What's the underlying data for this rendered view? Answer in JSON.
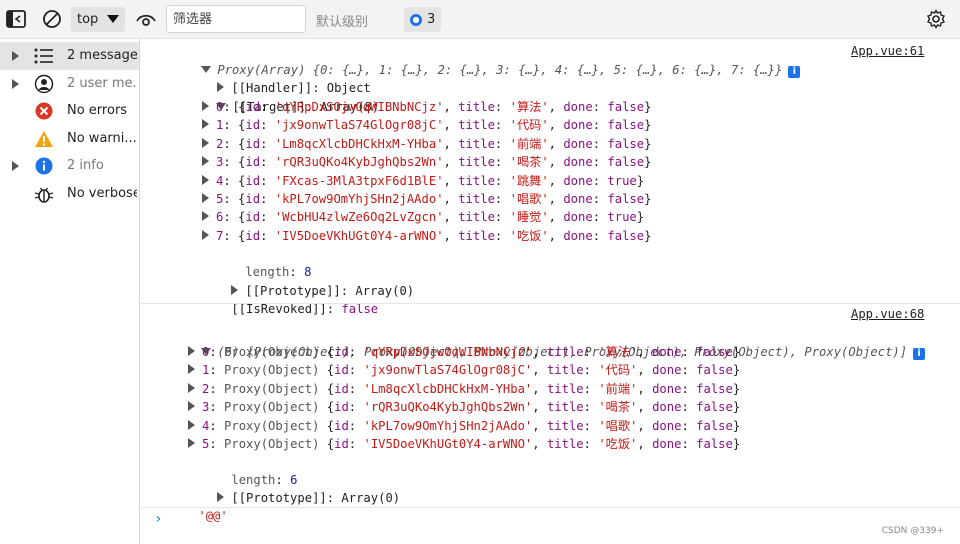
{
  "toolbar": {
    "context": "top",
    "filter_placeholder": "筛选器",
    "level": "默认级别",
    "issues_count": "3"
  },
  "sidebar": {
    "items": [
      {
        "label": "2 messages",
        "icon": "list-icon"
      },
      {
        "label": "2 user me...",
        "icon": "user-icon"
      },
      {
        "label": "No errors",
        "icon": "error-icon"
      },
      {
        "label": "No warni...",
        "icon": "warning-icon"
      },
      {
        "label": "2 info",
        "icon": "info-icon"
      },
      {
        "label": "No verbose",
        "icon": "bug-icon"
      }
    ]
  },
  "console": {
    "msg1": {
      "source": "App.vue:61",
      "summary": "Proxy(Array) {0: {…}, 1: {…}, 2: {…}, 3: {…}, 4: {…}, 5: {…}, 6: {…}, 7: {…}}",
      "handler": "[[Handler]]: Object",
      "target": "[[Target]]: Array(8)",
      "items": [
        {
          "idx": "0",
          "id": "qYRpDxSOjwOqWIBNbNCjz",
          "title": "算法",
          "done": "false"
        },
        {
          "idx": "1",
          "id": "jx9onwTlaS74GlOgr08jC",
          "title": "代码",
          "done": "false"
        },
        {
          "idx": "2",
          "id": "Lm8qcXlcbDHCkHxM-YHba",
          "title": "前端",
          "done": "false"
        },
        {
          "idx": "3",
          "id": "rQR3uQKo4KybJghQbs2Wn",
          "title": "喝茶",
          "done": "false"
        },
        {
          "idx": "4",
          "id": "FXcas-3MlA3tpxF6d1BlE",
          "title": "跳舞",
          "done": "true"
        },
        {
          "idx": "5",
          "id": "kPL7ow9OmYhjSHn2jAAdo",
          "title": "唱歌",
          "done": "false"
        },
        {
          "idx": "6",
          "id": "WcbHU4zlwZe6Oq2LvZgcn",
          "title": "睡觉",
          "done": "true"
        },
        {
          "idx": "7",
          "id": "IV5DoeVKhUGt0Y4-arWNO",
          "title": "吃饭",
          "done": "false"
        }
      ],
      "length_key": "length",
      "length_val": "8",
      "prototype": "[[Prototype]]: Array(0)",
      "revoked_key": "[[IsRevoked]]",
      "revoked_val": "false"
    },
    "msg2": {
      "source": "App.vue:68",
      "summary": "(6) [Proxy(Object), Proxy(Object), Proxy(Object), Proxy(Object), Proxy(Object), Proxy(Object)]",
      "items": [
        {
          "idx": "0",
          "id": "qYRpDxSOjwOqWIBNbNCjz",
          "title": "算法",
          "done": "false"
        },
        {
          "idx": "1",
          "id": "jx9onwTlaS74GlOgr08jC",
          "title": "代码",
          "done": "false"
        },
        {
          "idx": "2",
          "id": "Lm8qcXlcbDHCkHxM-YHba",
          "title": "前端",
          "done": "false"
        },
        {
          "idx": "3",
          "id": "rQR3uQKo4KybJghQbs2Wn",
          "title": "喝茶",
          "done": "false"
        },
        {
          "idx": "4",
          "id": "kPL7ow9OmYhjSHn2jAAdo",
          "title": "唱歌",
          "done": "false"
        },
        {
          "idx": "5",
          "id": "IV5DoeVKhUGt0Y4-arWNO",
          "title": "吃饭",
          "done": "false"
        }
      ],
      "length_key": "length",
      "length_val": "6",
      "prototype": "[[Prototype]]: Array(0)",
      "string_output": "'@@'"
    },
    "prompt": "›"
  },
  "watermark": "CSDN @339+"
}
